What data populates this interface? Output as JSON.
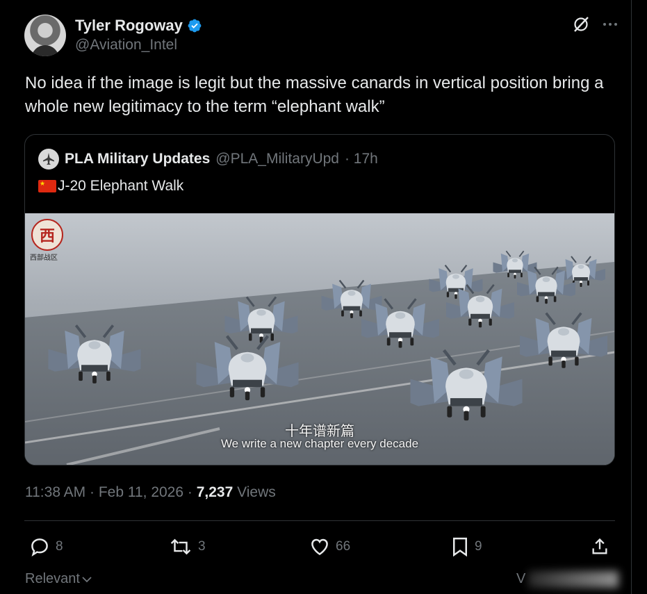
{
  "author": {
    "display_name": "Tyler Rogoway",
    "handle": "@Aviation_Intel",
    "verified_color": "#1d9bf0"
  },
  "top_icons": [
    "grok-icon",
    "more-icon"
  ],
  "tweet": {
    "text": "No idea if the image is legit but the massive canards in vertical position bring a whole new legitimacy to the term “elephant walk”"
  },
  "quote": {
    "name": "PLA Military Updates",
    "handle": "@PLA_MilitaryUpd",
    "age": "· 17h",
    "text": "J-20 Elephant Walk",
    "flag_icon": "china-flag-icon",
    "media": {
      "logo_text": "西",
      "logo_caption": "西部战区",
      "subtitle_cn": "十年谱新篇",
      "subtitle_en": "We write a new chapter every decade"
    }
  },
  "meta": {
    "time_date": "11:38 AM · Feb 11, 2026 · ",
    "views_count": "7,237",
    "views_label": " Views"
  },
  "actions": {
    "replies": "8",
    "reposts": "3",
    "likes": "66",
    "bookmarks": "9"
  },
  "footer": {
    "sort_label": "Relevant",
    "reply_initial": "V"
  },
  "colors": {
    "background": "#000000",
    "text": "#e7e9ea",
    "muted": "#71767b",
    "border": "#2f3336",
    "accent": "#1d9bf0"
  }
}
